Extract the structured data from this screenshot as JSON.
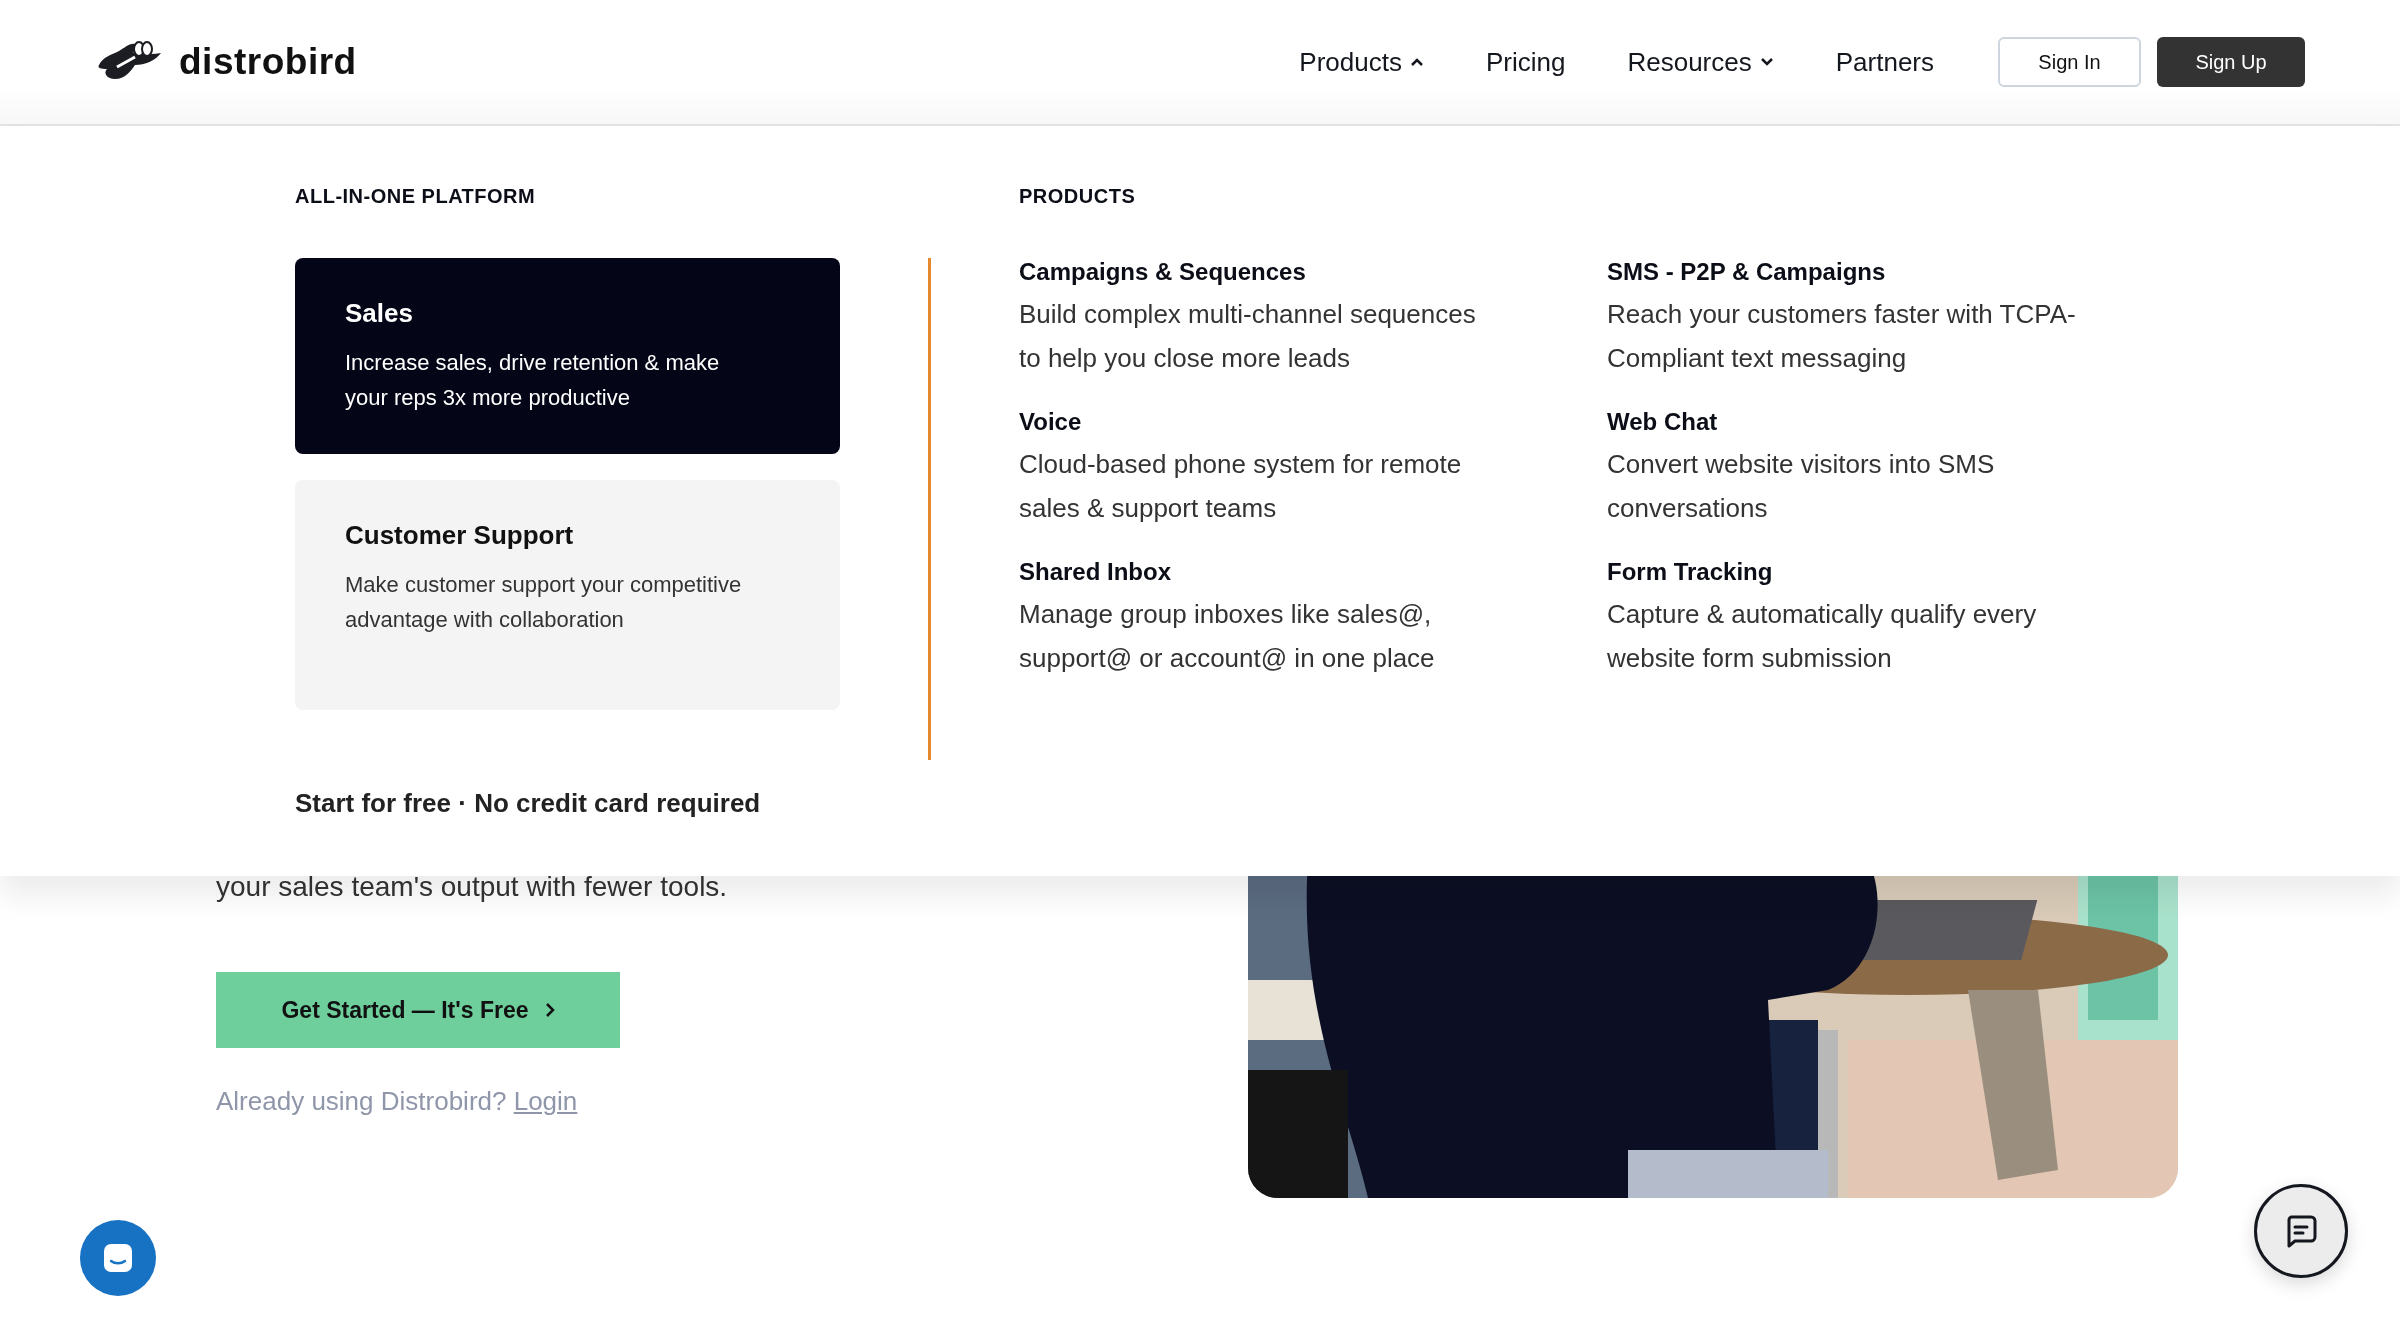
{
  "header": {
    "logo": "distrobird",
    "nav": [
      {
        "label": "Products",
        "kind": "dropdown",
        "expanded": true
      },
      {
        "label": "Pricing",
        "kind": "link"
      },
      {
        "label": "Resources",
        "kind": "dropdown",
        "expanded": false
      },
      {
        "label": "Partners",
        "kind": "link"
      }
    ],
    "sign_in": "Sign In",
    "sign_up": "Sign Up"
  },
  "menu": {
    "platform_heading": "ALL-IN-ONE PLATFORM",
    "platforms": [
      {
        "title": "Sales",
        "description": "Increase sales, drive retention & make your reps 3x more productive",
        "selected": true
      },
      {
        "title": "Customer Support",
        "description": "Make customer support your competitive advantage with collaboration",
        "selected": false
      }
    ],
    "footnote": "Start for free · No credit card required",
    "products_heading": "PRODUCTS",
    "products": [
      {
        "title": "Campaigns & Sequences",
        "description": "Build complex multi-channel sequences to help you close more leads"
      },
      {
        "title": "SMS - P2P & Campaigns",
        "description": "Reach your customers faster with TCPA-Compliant text messaging"
      },
      {
        "title": "Voice",
        "description": "Cloud-based phone system for remote sales & support teams"
      },
      {
        "title": "Web Chat",
        "description": "Convert website visitors into SMS conversations"
      },
      {
        "title": "Shared Inbox",
        "description": "Manage group inboxes like sales@, support@ or account@ in one place"
      },
      {
        "title": "Form Tracking",
        "description": "Capture & automatically qualify every website form submission"
      }
    ]
  },
  "hero": {
    "text": "your sales team's output with fewer tools.",
    "cta": "Get Started — It's Free",
    "login_prompt": "Already using Distrobird?",
    "login_link": "Login"
  }
}
